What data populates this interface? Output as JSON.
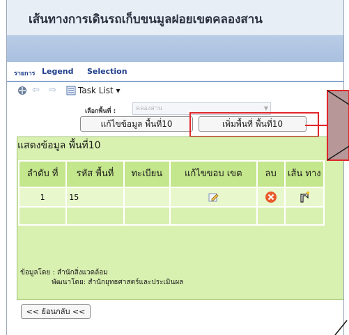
{
  "title": "เส้นทางการเดินรถเก็บขนมูลฝอยเขตคลองสาน",
  "tabs": [
    "รายการ",
    "Legend",
    "Selection"
  ],
  "toolbar": {
    "task_list": "Task List ▾"
  },
  "filter": {
    "label": "เลือกพื้นที่ :",
    "value": "คลองสาน"
  },
  "buttons": {
    "edit": "แก้ไขข้อมูล พื้นที่10",
    "add": "เพิ่มพื้นที่ พื้นที่10",
    "back": "<< ย้อนกลับ <<"
  },
  "section_title": "แสดงข้อมูล พื้นที่10",
  "table": {
    "headers": [
      "ลำดับ ที่",
      "รหัส พื้นที่",
      "ทะเบียน",
      "แก้ไขขอบ เขต",
      "ลบ",
      "เส้น ทาง"
    ],
    "rows": [
      {
        "seq": "1",
        "code": "15",
        "plate": ""
      }
    ]
  },
  "footer": {
    "line1": "ข้อมูลโดย : สำนักสิ่งแวดล้อม",
    "line2": "พัฒนาโดย: สำนักยุทธศาสตร์และประเมินผล"
  },
  "colors": {
    "accent_red": "#e0262a",
    "panel_green": "#d8f0b0",
    "header_green": "#c4e68c",
    "callout": "#b79797"
  }
}
